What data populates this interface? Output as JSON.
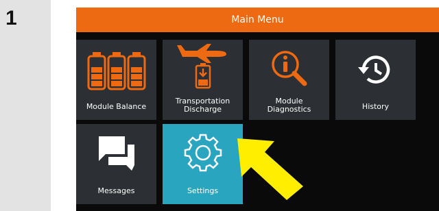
{
  "step": {
    "number": "1"
  },
  "screen": {
    "title": "Main Menu",
    "accent_color": "#ee6a12",
    "selected_color": "#2aa5c0",
    "tiles": [
      {
        "label": "Module Balance",
        "icon": "battery-modules-icon"
      },
      {
        "label_line1": "Transportation",
        "label_line2": "Discharge",
        "icon": "airplane-battery-icon"
      },
      {
        "label_line1": "Module",
        "label_line2": "Diagnostics",
        "icon": "magnifier-info-icon"
      },
      {
        "label": "History",
        "icon": "history-clock-icon"
      },
      {
        "label": "Messages",
        "icon": "chat-bubbles-icon"
      },
      {
        "label": "Settings",
        "icon": "gear-icon",
        "selected": true
      }
    ]
  },
  "callout": {
    "icon": "yellow-arrow-icon",
    "color": "#ffee00"
  }
}
